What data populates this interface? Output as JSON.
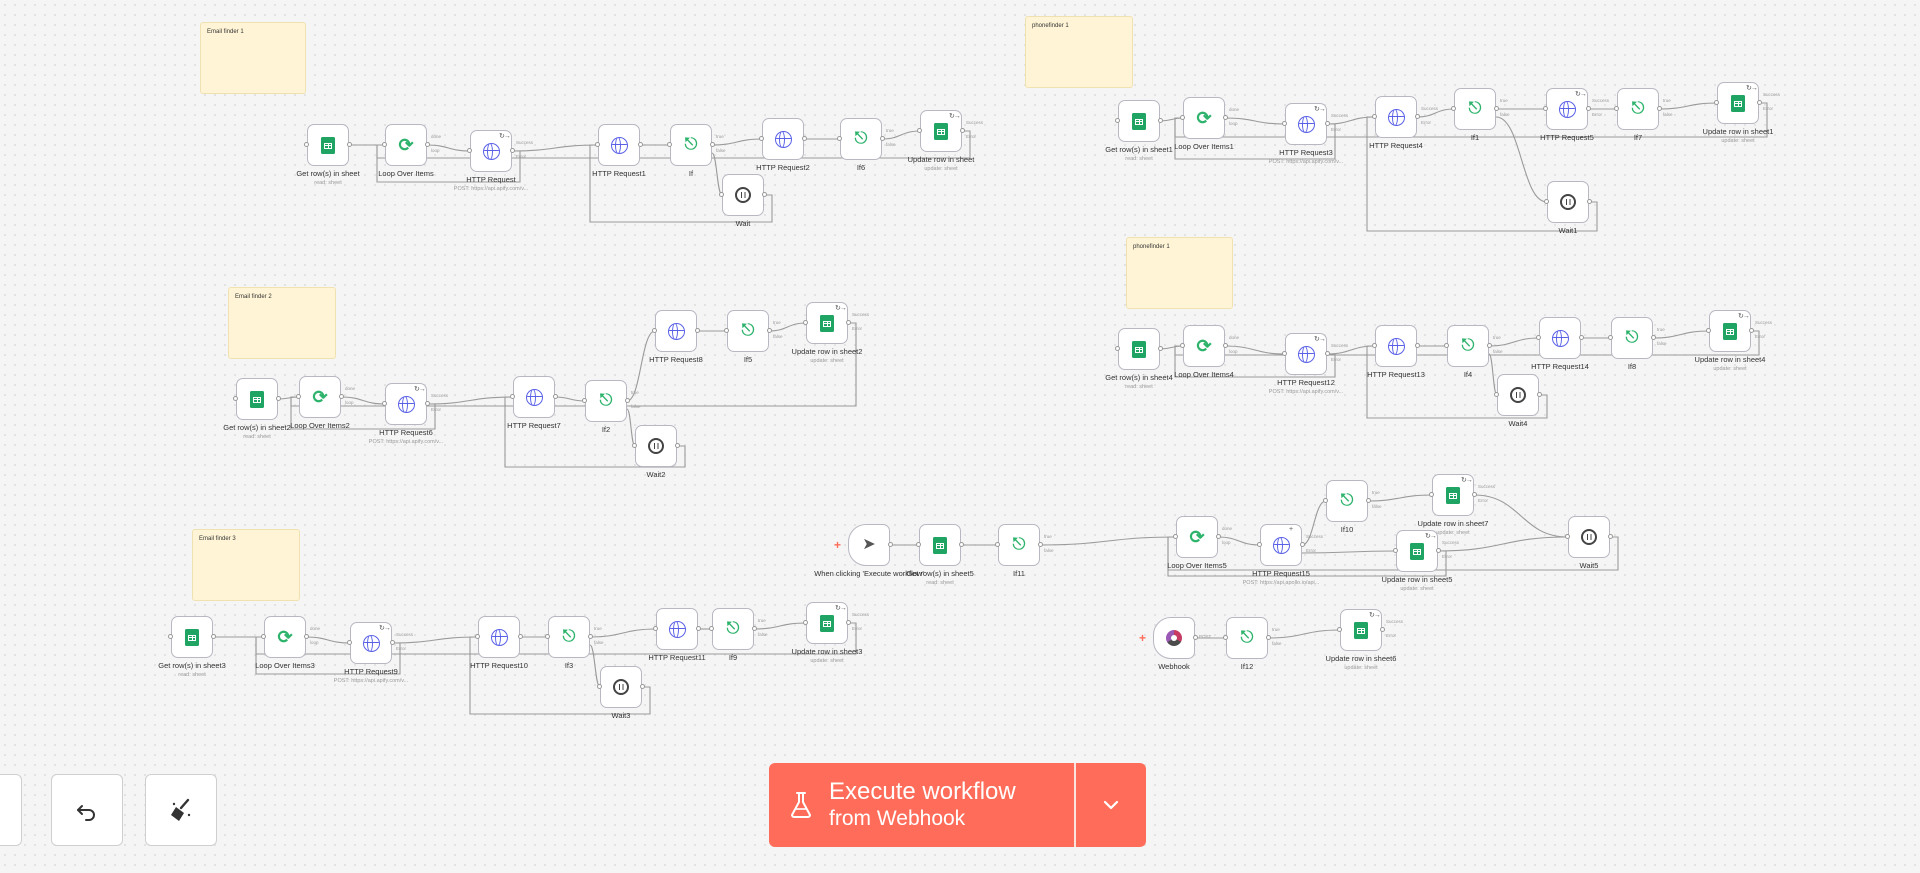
{
  "sticky_notes": [
    {
      "id": "s1",
      "text": "Email finder 1"
    },
    {
      "id": "s2",
      "text": "Email finder 2"
    },
    {
      "id": "s3",
      "text": "Email finder 3"
    },
    {
      "id": "s4",
      "text": "phonefinder 1"
    },
    {
      "id": "s5",
      "text": "phonefinder 1"
    }
  ],
  "nodes": [
    {
      "id": "n1",
      "type": "sheet",
      "title": "Get row(s) in sheet",
      "sub": "read: sheet"
    },
    {
      "id": "n2",
      "type": "loop",
      "title": "Loop Over Items",
      "outputs": [
        "done",
        "loop"
      ]
    },
    {
      "id": "n3",
      "type": "globe",
      "title": "HTTP Request",
      "sub": "POST: https://api.apify.com/v...",
      "badge": "↻→",
      "outputs": [
        "Success",
        "Error"
      ]
    },
    {
      "id": "n4",
      "type": "globe",
      "title": "HTTP Request1"
    },
    {
      "id": "n5",
      "type": "if",
      "title": "If",
      "outputs": [
        "true",
        "false"
      ]
    },
    {
      "id": "n6",
      "type": "globe",
      "title": "HTTP Request2"
    },
    {
      "id": "n7",
      "type": "if",
      "title": "If6",
      "outputs": [
        "true",
        "false"
      ]
    },
    {
      "id": "n8",
      "type": "sheet",
      "title": "Update row in sheet",
      "sub": "update: sheet",
      "badge": "↻→",
      "outputs": [
        "Success",
        "Error"
      ]
    },
    {
      "id": "n9",
      "type": "wait",
      "title": "Wait"
    },
    {
      "id": "n10",
      "type": "sheet",
      "title": "Get row(s) in sheet2",
      "sub": "read: sheet"
    },
    {
      "id": "n11",
      "type": "loop",
      "title": "Loop Over Items2",
      "outputs": [
        "done",
        "loop"
      ]
    },
    {
      "id": "n12",
      "type": "globe",
      "title": "HTTP Request6",
      "sub": "POST: https://api.apify.com/v...",
      "badge": "↻→",
      "outputs": [
        "Success",
        "Error"
      ]
    },
    {
      "id": "n13",
      "type": "globe",
      "title": "HTTP Request7"
    },
    {
      "id": "n14",
      "type": "if",
      "title": "If2",
      "outputs": [
        "true",
        "false"
      ]
    },
    {
      "id": "n15",
      "type": "globe",
      "title": "HTTP Request8"
    },
    {
      "id": "n16",
      "type": "if",
      "title": "If5",
      "outputs": [
        "true",
        "false"
      ]
    },
    {
      "id": "n17",
      "type": "sheet",
      "title": "Update row in sheet2",
      "sub": "update: sheet",
      "badge": "↻→",
      "outputs": [
        "Success",
        "Error"
      ]
    },
    {
      "id": "n18",
      "type": "wait",
      "title": "Wait2"
    },
    {
      "id": "n19",
      "type": "sheet",
      "title": "Get row(s) in sheet3",
      "sub": "read: sheet"
    },
    {
      "id": "n20",
      "type": "loop",
      "title": "Loop Over Items3",
      "outputs": [
        "done",
        "loop"
      ]
    },
    {
      "id": "n21",
      "type": "globe",
      "title": "HTTP Request9",
      "sub": "POST: https://api.apify.com/v...",
      "badge": "↻→",
      "outputs": [
        "Success",
        "Error"
      ]
    },
    {
      "id": "n22",
      "type": "globe",
      "title": "HTTP Request10"
    },
    {
      "id": "n23",
      "type": "if",
      "title": "If3",
      "outputs": [
        "true",
        "false"
      ]
    },
    {
      "id": "n24",
      "type": "globe",
      "title": "HTTP Request11"
    },
    {
      "id": "n25",
      "type": "if",
      "title": "If9",
      "outputs": [
        "true",
        "false"
      ]
    },
    {
      "id": "n26",
      "type": "sheet",
      "title": "Update row in sheet3",
      "sub": "update: sheet",
      "badge": "↻→",
      "outputs": [
        "Success",
        "Error"
      ]
    },
    {
      "id": "n27",
      "type": "wait",
      "title": "Wait3"
    },
    {
      "id": "n28",
      "type": "sheet",
      "title": "Get row(s) in sheet1",
      "sub": "read: sheet"
    },
    {
      "id": "n29",
      "type": "loop",
      "title": "Loop Over Items1",
      "outputs": [
        "done",
        "loop"
      ]
    },
    {
      "id": "n30",
      "type": "globe",
      "title": "HTTP Request3",
      "sub": "POST: https://api.apify.com/v...",
      "badge": "↻→",
      "outputs": [
        "Success",
        "Error"
      ]
    },
    {
      "id": "n31",
      "type": "globe",
      "title": "HTTP Request4",
      "outputs": [
        "Success",
        "Error"
      ]
    },
    {
      "id": "n32",
      "type": "if",
      "title": "If1",
      "outputs": [
        "true",
        "false"
      ]
    },
    {
      "id": "n33",
      "type": "globe",
      "title": "HTTP Request5",
      "badge": "↻→",
      "outputs": [
        "Success",
        "Error"
      ]
    },
    {
      "id": "n34",
      "type": "if",
      "title": "If7",
      "outputs": [
        "true",
        "false"
      ]
    },
    {
      "id": "n35",
      "type": "sheet",
      "title": "Update row in sheet1",
      "sub": "update: sheet",
      "badge": "↻→",
      "outputs": [
        "Success",
        "Error"
      ]
    },
    {
      "id": "n36",
      "type": "wait",
      "title": "Wait1"
    },
    {
      "id": "n37",
      "type": "sheet",
      "title": "Get row(s) in sheet4",
      "sub": "read: sheet"
    },
    {
      "id": "n38",
      "type": "loop",
      "title": "Loop Over Items4",
      "outputs": [
        "done",
        "loop"
      ]
    },
    {
      "id": "n39",
      "type": "globe",
      "title": "HTTP Request12",
      "sub": "POST: https://api.apify.com/v...",
      "badge": "↻→",
      "outputs": [
        "Success",
        "Error"
      ]
    },
    {
      "id": "n40",
      "type": "globe",
      "title": "HTTP Request13"
    },
    {
      "id": "n41",
      "type": "if",
      "title": "If4",
      "outputs": [
        "true",
        "false"
      ]
    },
    {
      "id": "n42",
      "type": "globe",
      "title": "HTTP Request14"
    },
    {
      "id": "n43",
      "type": "if",
      "title": "If8",
      "outputs": [
        "true",
        "false"
      ]
    },
    {
      "id": "n44",
      "type": "sheet",
      "title": "Update row in sheet4",
      "sub": "update: sheet",
      "badge": "↻→",
      "outputs": [
        "Success",
        "Error"
      ]
    },
    {
      "id": "n45",
      "type": "wait",
      "title": "Wait4"
    },
    {
      "id": "n46",
      "type": "cursor",
      "trigger": true,
      "title": "When clicking 'Execute workflow'"
    },
    {
      "id": "n47",
      "type": "sheet",
      "title": "Get row(s) in sheet5",
      "sub": "read: sheet"
    },
    {
      "id": "n48",
      "type": "if",
      "title": "If11",
      "outputs": [
        "true",
        "false"
      ]
    },
    {
      "id": "n49",
      "type": "loop",
      "title": "Loop Over Items5",
      "outputs": [
        "done",
        "loop"
      ]
    },
    {
      "id": "n50",
      "type": "globe",
      "title": "HTTP Request15",
      "sub": "POST: https://api.apollo.io/api...",
      "badge": "+",
      "outputs": [
        "Success",
        "Error"
      ]
    },
    {
      "id": "n51",
      "type": "if",
      "title": "If10",
      "outputs": [
        "true",
        "false"
      ]
    },
    {
      "id": "n52",
      "type": "sheet",
      "title": "Update row in sheet7",
      "sub": "update: sheet",
      "badge": "↻→",
      "outputs": [
        "Success",
        "Error"
      ]
    },
    {
      "id": "n53",
      "type": "sheet",
      "title": "Update row in sheet5",
      "sub": "update: sheet",
      "badge": "↻→",
      "outputs": [
        "Success",
        "Error"
      ]
    },
    {
      "id": "n54",
      "type": "wait",
      "title": "Wait5"
    },
    {
      "id": "n55",
      "type": "hook",
      "trigger": true,
      "title": "Webhook",
      "outputs": [
        "POST"
      ]
    },
    {
      "id": "n56",
      "type": "if",
      "title": "If12",
      "outputs": [
        "true",
        "false"
      ]
    },
    {
      "id": "n57",
      "type": "sheet",
      "title": "Update row in sheet6",
      "sub": "update: sheet",
      "badge": "↻→",
      "outputs": [
        "Success",
        "Error"
      ]
    }
  ],
  "controls": [
    {
      "id": "zoom",
      "icon": "zoom-icon"
    },
    {
      "id": "undo",
      "icon": "undo-icon"
    },
    {
      "id": "tidy",
      "icon": "broom-icon"
    }
  ],
  "execute": {
    "line1": "Execute workflow",
    "line2": "from Webhook",
    "icon": "flask-icon",
    "dropdown_icon": "chevron-down-icon",
    "color": "#ff6d5a"
  },
  "colors": {
    "sheet": "#1fa463",
    "http": "#5a61e6",
    "logic": "#2db36c",
    "accent": "#ff6d5a",
    "sticky": "#fff5d6"
  }
}
